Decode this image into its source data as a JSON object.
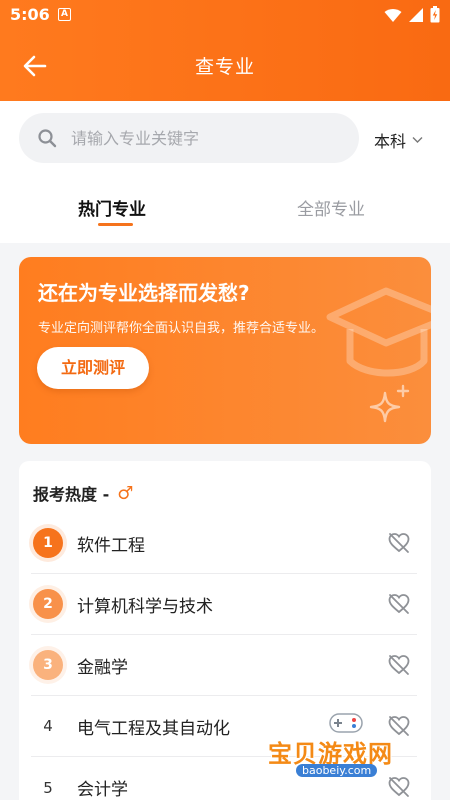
{
  "status": {
    "time": "5:06",
    "app_badge": "A"
  },
  "header": {
    "title": "查专业"
  },
  "search": {
    "placeholder": "请输入专业关键字",
    "level": "本科"
  },
  "tabs": [
    {
      "label": "热门专业",
      "active": true
    },
    {
      "label": "全部专业",
      "active": false
    }
  ],
  "banner": {
    "title": "还在为专业选择而发愁?",
    "subtitle": "专业定向测评帮你全面认识自我，推荐合适专业。",
    "button": "立即测评"
  },
  "ranking": {
    "heading": "报考热度 -",
    "gender_symbol": "♂",
    "items": [
      {
        "rank": "1",
        "name": "软件工程"
      },
      {
        "rank": "2",
        "name": "计算机科学与技术"
      },
      {
        "rank": "3",
        "name": "金融学"
      },
      {
        "rank": "4",
        "name": "电气工程及其自动化"
      },
      {
        "rank": "5",
        "name": "会计学"
      }
    ]
  },
  "watermark": {
    "text": "宝贝游戏网",
    "url": "baobeiy.com"
  },
  "colors": {
    "accent": "#f5731c",
    "header": "#fa6d14"
  },
  "icons": {
    "back": "arrow-left-icon",
    "search": "search-icon",
    "dropdown": "chevron-down-icon",
    "favorite": "heart-off-icon",
    "wifi": "wifi-icon",
    "signal": "signal-icon",
    "battery": "battery-icon",
    "cap": "graduation-cap-icon",
    "sparkle": "sparkle-icon"
  }
}
